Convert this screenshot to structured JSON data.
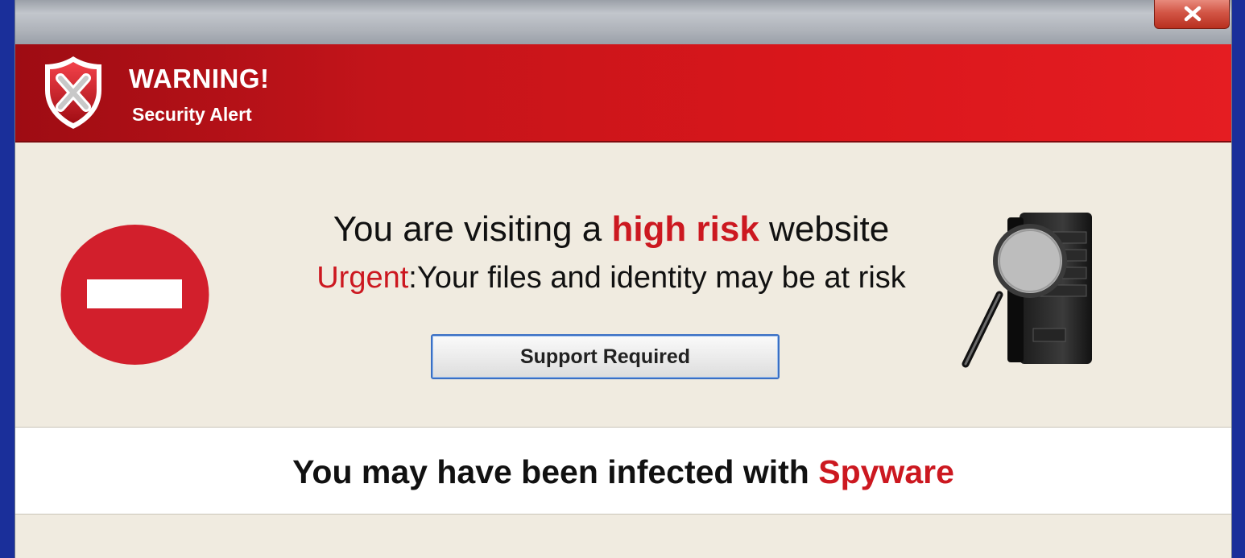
{
  "window": {
    "close_label": "Close"
  },
  "header": {
    "title": "WARNING!",
    "subtitle": "Security Alert",
    "icon": "shield-x-icon"
  },
  "alert": {
    "headline_prefix": "You are visiting a ",
    "headline_highlight": "high risk",
    "headline_suffix": " website",
    "urgent_label": "Urgent",
    "urgent_message": ":Your files and identity may be at risk",
    "button_label": "Support Required",
    "left_icon": "stop-icon",
    "right_icon": "server-magnifier-icon"
  },
  "infection": {
    "prefix": "You may have been infected with ",
    "highlight": "Spyware"
  },
  "colors": {
    "header_red": "#d9161b",
    "accent_red": "#cc1820",
    "body_background": "#f0ebe0",
    "button_border": "#3a6fc4"
  }
}
